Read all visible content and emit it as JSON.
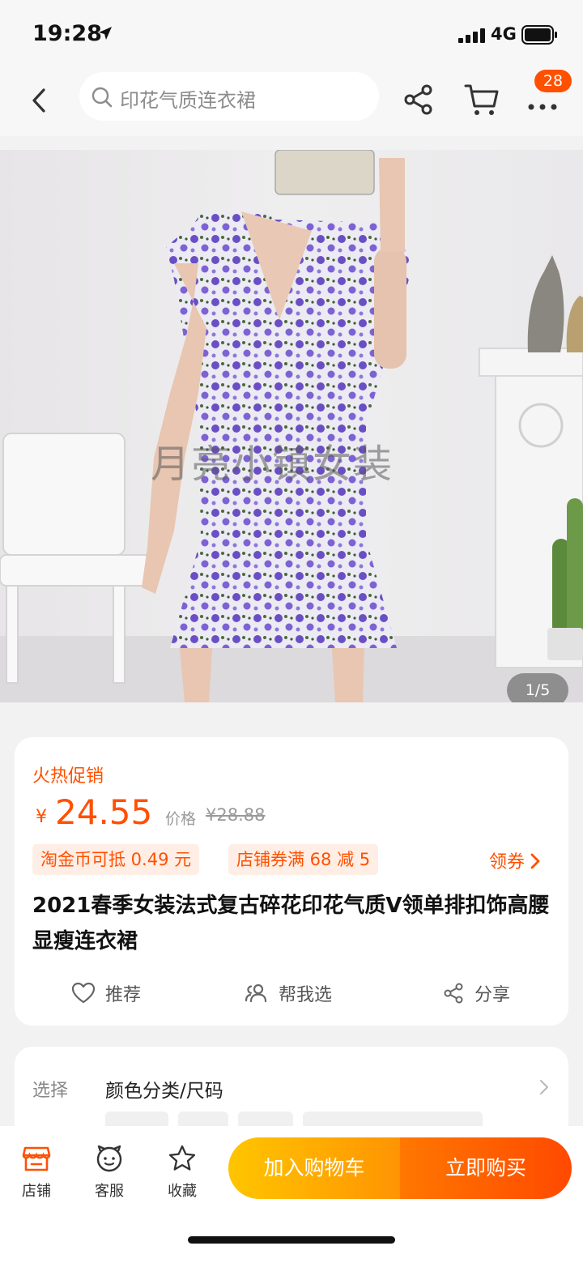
{
  "status_bar": {
    "time": "19:28",
    "network": "4G"
  },
  "search": {
    "placeholder": "印花气质连衣裙"
  },
  "header": {
    "badge_count": "28"
  },
  "gallery": {
    "watermark": "月亮小镇女装",
    "indicator": "1/5"
  },
  "product": {
    "promo_tag": "火热促销",
    "currency": "¥",
    "price": "24.55",
    "original_label": "价格",
    "original_price": "¥28.88",
    "coupons": [
      "淘金币可抵 0.49 元",
      "店铺券满 68 减 5"
    ],
    "get_coupon": "领券",
    "title": "2021春季女装法式复古碎花印花气质V领单排扣饰高腰显瘦连衣裙",
    "actions": {
      "recommend": "推荐",
      "help_choose": "帮我选",
      "share": "分享"
    }
  },
  "options": {
    "label": "选择",
    "value": "颜色分类/尺码"
  },
  "bottom_bar": {
    "store": "店铺",
    "service": "客服",
    "favorite": "收藏",
    "add_to_cart": "加入购物车",
    "buy_now": "立即购买"
  },
  "colors": {
    "accent": "#ff5000",
    "cart_gradient": [
      "#ffc500",
      "#ff9402"
    ],
    "buy_gradient": [
      "#ff7700",
      "#ff4900"
    ]
  }
}
